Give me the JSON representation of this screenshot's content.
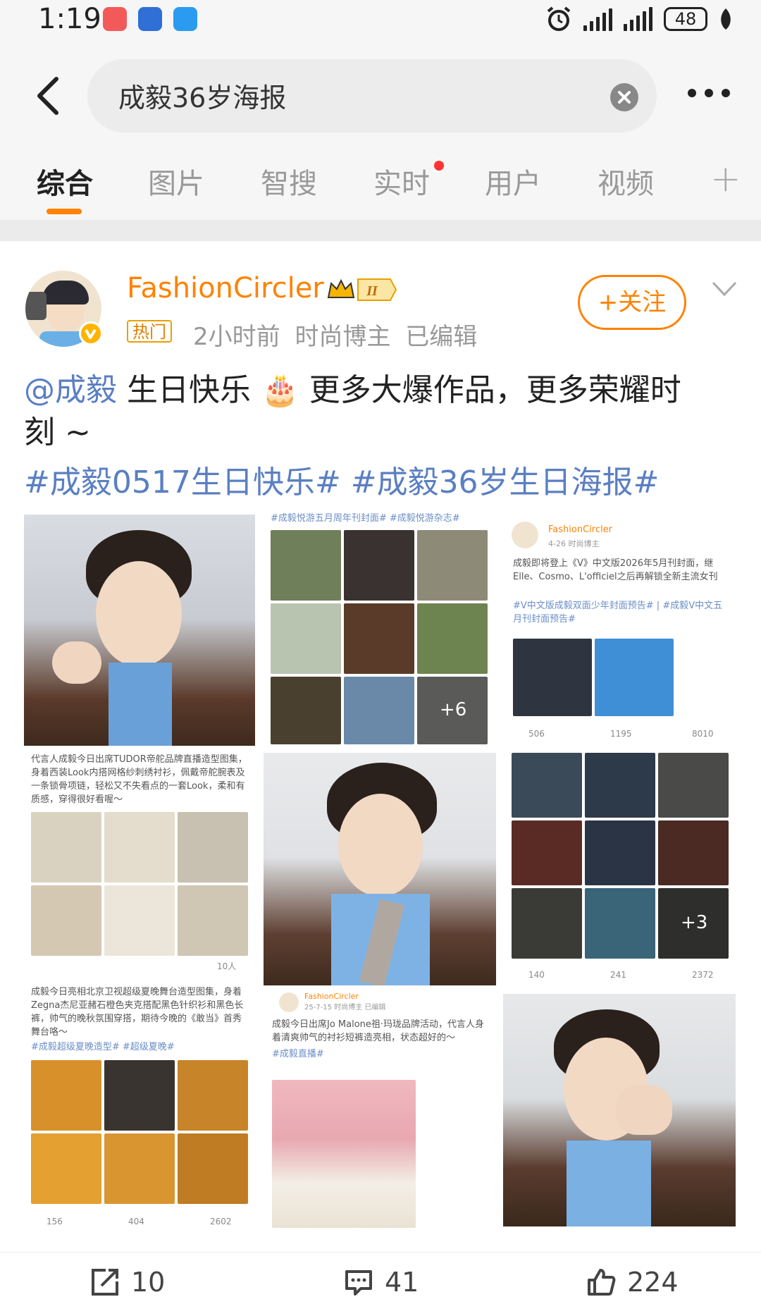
{
  "status_bar": {
    "time": "1:19",
    "battery": "48"
  },
  "search": {
    "query": "成毅36岁海报"
  },
  "tabs": [
    {
      "label": "综合",
      "active": true
    },
    {
      "label": "图片"
    },
    {
      "label": "智搜"
    },
    {
      "label": "实时",
      "has_dot": true
    },
    {
      "label": "用户"
    },
    {
      "label": "视频"
    }
  ],
  "post": {
    "username": "FashionCircler",
    "level_badge": "II",
    "hot_label": "热门",
    "meta": "2小时前  时尚博主  已编辑",
    "follow_label": "+关注",
    "mention": "@成毅",
    "text_line1": " 生日快乐 🎂 更多大爆作品，更多荣耀时",
    "text_line2": "刻 ~",
    "hashtags": "#成毅0517生日快乐# #成毅36岁生日海报#"
  },
  "grid": {
    "c2_tags": "#成毅悦游五月周年刊封面# #成毅悦游杂志#",
    "c2_more": "+6",
    "c3_user": "FashionCircler",
    "c3_date": "4-26  时尚博主",
    "c3_text": "成毅即将登上《V》中文版2026年5月刊封面，继Elle、Cosmo、L'officiel之后再解锁全新主流女刊",
    "c3_tags": "#V中文版成毅双面少年封面预告# | #成毅V中文五月刊封面预告#",
    "c3_stats": [
      "506",
      "1195",
      "8010"
    ],
    "c4_text": "代言人成毅今日出席TUDOR帝舵品牌直播造型图集，身着西装Look内搭网格纱刺绣衬衫，佩戴帝舵腕表及一条锁骨项链，轻松又不失看点的一套Look，柔和有质感，穿得很好看喔～",
    "c4_footer": "10人",
    "c6_more": "+3",
    "c6_stats": [
      "140",
      "241",
      "2372"
    ],
    "c7_text": "成毅今日亮相北京卫视超级夏晚舞台造型图集，身着Zegna杰尼亚赭石橙色夹克搭配黑色针织衫和黑色长裤，帅气的晚秋氛围穿搭，期待今晚的《敢当》首秀舞台咯～",
    "c7_tags": "#成毅超级夏晚造型# #超级夏晚#",
    "c7_stats": [
      "156",
      "404",
      "2602"
    ],
    "c8_user": "FashionCircler",
    "c8_date": "25-7-15  时尚博主  已编辑",
    "c8_text": "成毅今日出席Jo Malone祖·玛珑品牌活动，代言人身着清爽帅气的衬衫短裤造亮相，状态超好的～",
    "c8_tags": "#成毅直播#"
  },
  "actions": {
    "reposts": "10",
    "comments": "41",
    "likes": "224"
  },
  "colors": {
    "accent": "#ff8200",
    "link": "#5a7fc2"
  }
}
